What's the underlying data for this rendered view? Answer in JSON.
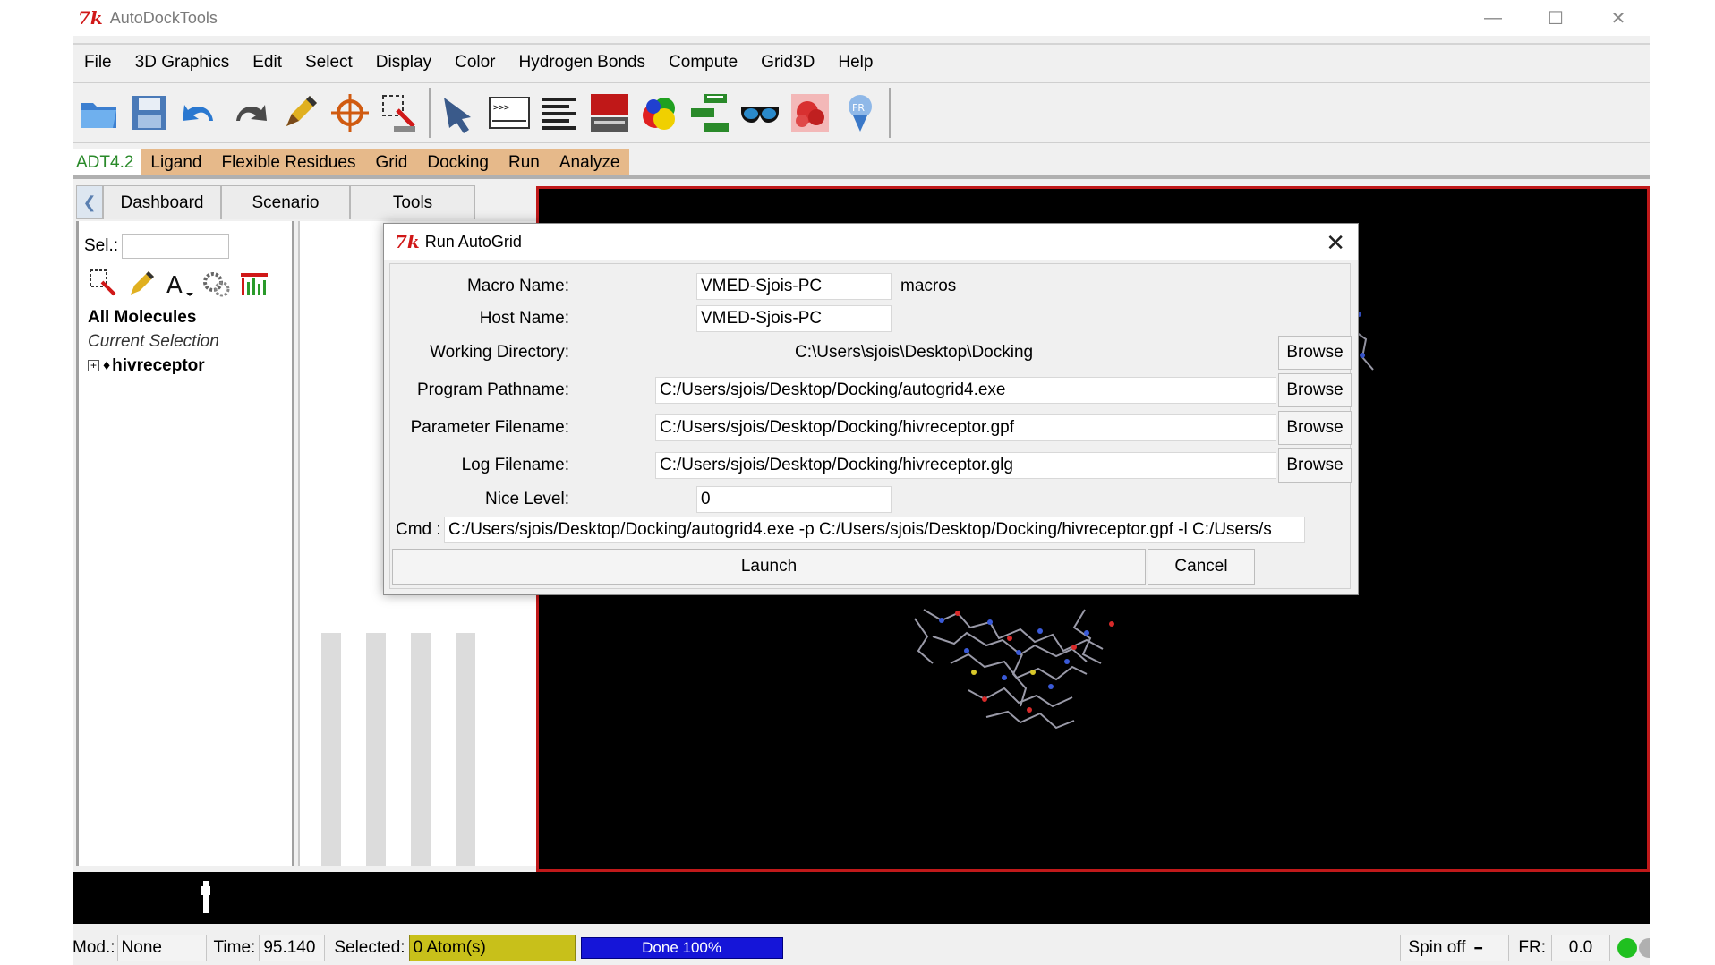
{
  "window": {
    "title": "AutoDockTools",
    "minimize": "—",
    "maximize": "☐",
    "close": "✕"
  },
  "menubar": [
    "File",
    "3D Graphics",
    "Edit",
    "Select",
    "Display",
    "Color",
    "Hydrogen Bonds",
    "Compute",
    "Grid3D",
    "Help"
  ],
  "adt_tabs": [
    "ADT4.2",
    "Ligand",
    "Flexible Residues",
    "Grid",
    "Docking",
    "Run",
    "Analyze"
  ],
  "dashboard": {
    "tabs": [
      "Dashboard",
      "Scenario",
      "Tools"
    ],
    "sel_label": "Sel.:",
    "all_molecules": "All Molecules",
    "current_selection": "Current Selection",
    "molecule": "hivreceptor"
  },
  "dialog": {
    "title": "Run AutoGrid",
    "macro_name_label": "Macro Name:",
    "macro_name_value": "VMED-Sjois-PC",
    "macros_label": "macros",
    "host_name_label": "Host Name:",
    "host_name_value": "VMED-Sjois-PC",
    "working_dir_label": "Working Directory:",
    "working_dir_value": "C:\\Users\\sjois\\Desktop\\Docking",
    "program_label": "Program Pathname:",
    "program_value": "C:/Users/sjois/Desktop/Docking/autogrid4.exe",
    "param_label": "Parameter Filename:",
    "param_value": "C:/Users/sjois/Desktop/Docking/hivreceptor.gpf",
    "log_label": "Log Filename:",
    "log_value": "C:/Users/sjois/Desktop/Docking/hivreceptor.glg",
    "nice_label": "Nice Level:",
    "nice_value": "0",
    "cmd_label": "Cmd :",
    "cmd_value": "C:/Users/sjois/Desktop/Docking/autogrid4.exe -p C:/Users/sjois/Desktop/Docking/hivreceptor.gpf -l C:/Users/s",
    "browse_label": "Browse",
    "launch_label": "Launch",
    "cancel_label": "Cancel"
  },
  "statusbar": {
    "mod_label": "Mod.:",
    "mod_value": "None",
    "time_label": "Time:",
    "time_value": "95.140",
    "selected_label": "Selected:",
    "selected_value": "0 Atom(s)",
    "progress_text": "Done 100%",
    "progress_fraction": 1.0,
    "spin_label": "Spin off",
    "fr_label": "FR:",
    "fr_value": "0.0"
  },
  "colors": {
    "viewer_border": "#c0191a",
    "adt_tab_bg": "#e6b98a",
    "progress_bar": "#1515d8",
    "selected_field": "#c8c01a"
  }
}
